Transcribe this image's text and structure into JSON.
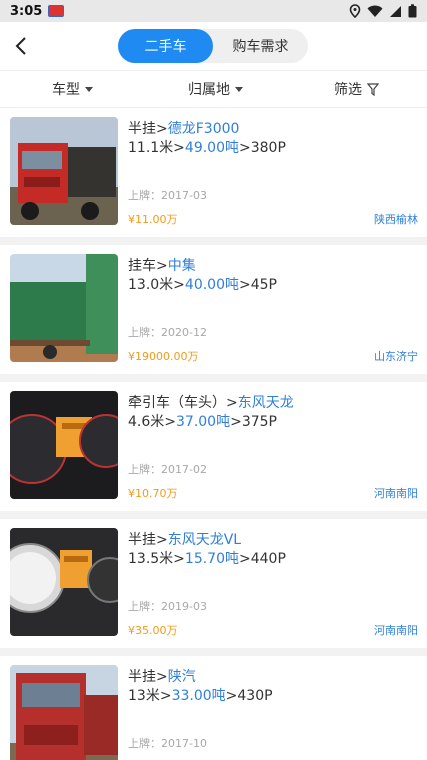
{
  "status_bar": {
    "time": "3:05"
  },
  "tabs": [
    {
      "label": "二手车",
      "active": true
    },
    {
      "label": "购车需求",
      "active": false
    }
  ],
  "filters": [
    {
      "label": "车型"
    },
    {
      "label": "归属地"
    },
    {
      "label": "筛选"
    }
  ],
  "listings": [
    {
      "category": "半挂",
      "brand": "德龙F3000",
      "length": "11.1米",
      "tonnage": "49.00吨",
      "horsepower": "380P",
      "plate_label": "上牌：",
      "plate_date": "2017-03",
      "price": "¥11.00万",
      "location": "陕西榆林"
    },
    {
      "category": "挂车",
      "brand": "中集",
      "length": "13.0米",
      "tonnage": "40.00吨",
      "horsepower": "45P",
      "plate_label": "上牌：",
      "plate_date": "2020-12",
      "price": "¥19000.00万",
      "location": "山东济宁"
    },
    {
      "category": "牵引车（车头）",
      "brand": "东风天龙",
      "length": "4.6米",
      "tonnage": "37.00吨",
      "horsepower": "375P",
      "plate_label": "上牌：",
      "plate_date": "2017-02",
      "price": "¥10.70万",
      "location": "河南南阳"
    },
    {
      "category": "半挂",
      "brand": "东风天龙VL",
      "length": "13.5米",
      "tonnage": "15.70吨",
      "horsepower": "440P",
      "plate_label": "上牌：",
      "plate_date": "2019-03",
      "price": "¥35.00万",
      "location": "河南南阳"
    },
    {
      "category": "半挂",
      "brand": "陕汽",
      "length": "13米",
      "tonnage": "33.00吨",
      "horsepower": "430P",
      "plate_label": "上牌：",
      "plate_date": "2017-10",
      "price": "",
      "location": ""
    }
  ],
  "colors": {
    "accent": "#1f8bf2",
    "link": "#2f7fd9",
    "price": "#f29a19"
  }
}
